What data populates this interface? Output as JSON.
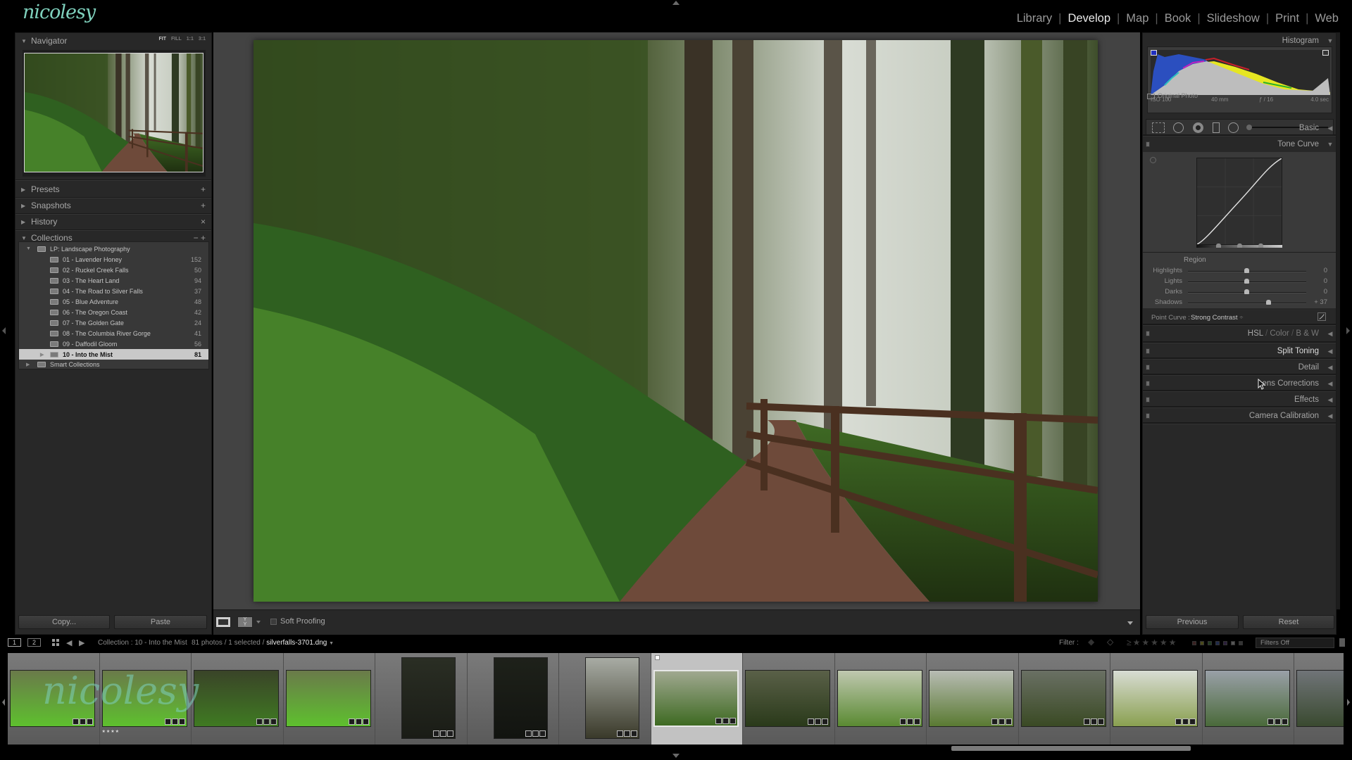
{
  "brand": {
    "logo_text": "nicolesy",
    "watermark_text": "nicolesy",
    "accent_color": "#7fd1bd"
  },
  "modules": [
    {
      "label": "Library",
      "active": false
    },
    {
      "label": "Develop",
      "active": true
    },
    {
      "label": "Map",
      "active": false
    },
    {
      "label": "Book",
      "active": false
    },
    {
      "label": "Slideshow",
      "active": false
    },
    {
      "label": "Print",
      "active": false
    },
    {
      "label": "Web",
      "active": false
    }
  ],
  "left_panel": {
    "navigator": {
      "title": "Navigator",
      "zoom_options": [
        "FIT",
        "FILL",
        "1:1",
        "3:1"
      ],
      "active_zoom": "FIT"
    },
    "sections": [
      {
        "title": "Presets",
        "action": "+"
      },
      {
        "title": "Snapshots",
        "action": "+"
      },
      {
        "title": "History",
        "action": "×"
      },
      {
        "title": "Collections",
        "action": "− +"
      }
    ],
    "collections": {
      "set_name": "LP: Landscape Photography",
      "items": [
        {
          "name": "01 - Lavender Honey",
          "count": "152"
        },
        {
          "name": "02 - Ruckel Creek Falls",
          "count": "50"
        },
        {
          "name": "03 - The Heart Land",
          "count": "94"
        },
        {
          "name": "04 - The Road to Silver Falls",
          "count": "37"
        },
        {
          "name": "05 - Blue Adventure",
          "count": "48"
        },
        {
          "name": "06 - The Oregon Coast",
          "count": "42"
        },
        {
          "name": "07 - The Golden Gate",
          "count": "24"
        },
        {
          "name": "08 - The Columbia River Gorge",
          "count": "41"
        },
        {
          "name": "09 - Daffodil Gloom",
          "count": "56"
        },
        {
          "name": "10 - Into the Mist",
          "count": "81",
          "selected": true
        }
      ],
      "smart_collections": "Smart Collections"
    },
    "buttons": {
      "copy": "Copy...",
      "paste": "Paste"
    }
  },
  "center": {
    "toolbar": {
      "soft_proofing": "Soft Proofing",
      "soft_proofing_checked": false
    }
  },
  "right_panel": {
    "histogram": {
      "title": "Histogram",
      "iso": "ISO 100",
      "focal_length": "40 mm",
      "aperture": "ƒ / 16",
      "shutter": "4.0 sec",
      "original_photo": "Original Photo"
    },
    "tools": [
      "crop-overlay",
      "spot-removal",
      "red-eye",
      "graduated-filter",
      "radial-filter",
      "adjustment-brush"
    ],
    "sections": {
      "basic": "Basic",
      "tone_curve": "Tone Curve",
      "hsl_color_bw": [
        "HSL",
        "Color",
        "B & W"
      ],
      "split_toning": "Split Toning",
      "detail": "Detail",
      "lens_corrections": "Lens Corrections",
      "effects": "Effects",
      "camera_calibration": "Camera Calibration"
    },
    "tone_curve": {
      "region_label": "Region",
      "sliders": [
        {
          "label": "Highlights",
          "value": "0",
          "fraction": 0.5
        },
        {
          "label": "Lights",
          "value": "0",
          "fraction": 0.5
        },
        {
          "label": "Darks",
          "value": "0",
          "fraction": 0.5
        },
        {
          "label": "Shadows",
          "value": "+ 37",
          "fraction": 0.685
        }
      ],
      "point_curve_label": "Point Curve :",
      "point_curve_value": "Strong Contrast"
    },
    "buttons": {
      "previous": "Previous",
      "reset": "Reset"
    }
  },
  "filmstrip_bar": {
    "screens": [
      "1",
      "2"
    ],
    "source": "Collection : 10 - Into the Mist",
    "count": "81 photos / 1 selected /",
    "filename": "silverfalls-3701.dng",
    "filter_label": "Filter :",
    "filter_preset": "Filters Off"
  },
  "filmstrip": {
    "thumbnails": [
      {
        "orientation": "landscape",
        "tone": "bright-green"
      },
      {
        "orientation": "landscape",
        "tone": "bright-green",
        "rating": "★★★★"
      },
      {
        "orientation": "landscape",
        "tone": "dark-green"
      },
      {
        "orientation": "landscape",
        "tone": "bright-green"
      },
      {
        "orientation": "portrait",
        "tone": "dark-forest"
      },
      {
        "orientation": "portrait",
        "tone": "darker-forest"
      },
      {
        "orientation": "portrait",
        "tone": "misty-forest"
      },
      {
        "orientation": "landscape",
        "tone": "fern-path",
        "selected": true
      },
      {
        "orientation": "landscape",
        "tone": "fern-path-dark"
      },
      {
        "orientation": "landscape",
        "tone": "fern-path-bright"
      },
      {
        "orientation": "landscape",
        "tone": "misty-canyon"
      },
      {
        "orientation": "landscape",
        "tone": "misty-canyon-dark"
      },
      {
        "orientation": "landscape",
        "tone": "misty-canyon-bright"
      },
      {
        "orientation": "landscape",
        "tone": "river-forest"
      },
      {
        "orientation": "landscape",
        "tone": "river-forest-dark"
      }
    ]
  }
}
